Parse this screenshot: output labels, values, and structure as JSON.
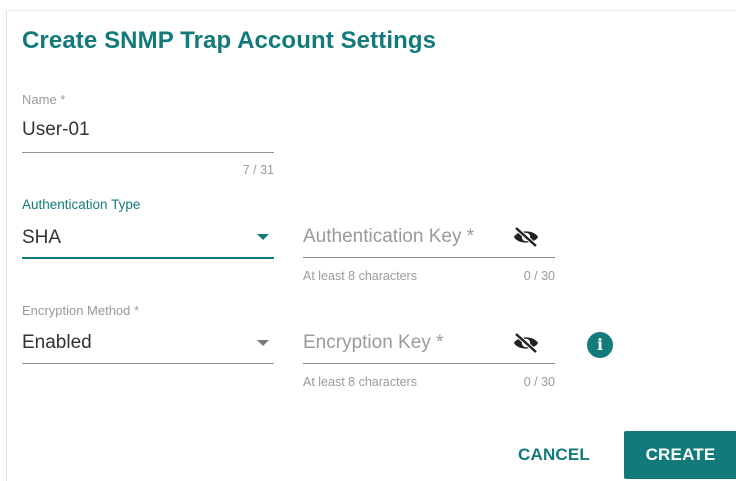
{
  "dialog": {
    "title": "Create SNMP Trap Account Settings"
  },
  "name_field": {
    "label": "Name *",
    "value": "User-01",
    "counter": "7 / 31"
  },
  "auth_type_field": {
    "label": "Authentication Type",
    "value": "SHA"
  },
  "auth_key_field": {
    "placeholder": "Authentication Key *",
    "hint": "At least 8 characters",
    "counter": "0 / 30",
    "visibility_icon": "eye-off-icon"
  },
  "encryption_method_field": {
    "label": "Encryption Method *",
    "value": "Enabled"
  },
  "encryption_key_field": {
    "placeholder": "Encryption Key *",
    "hint": "At least 8 characters",
    "counter": "0 / 30",
    "visibility_icon": "eye-off-icon",
    "info_icon_glyph": "i"
  },
  "actions": {
    "cancel_label": "CANCEL",
    "create_label": "CREATE"
  },
  "colors": {
    "accent": "#137a7c",
    "muted_text": "#9a9a9a",
    "text": "#333333"
  }
}
